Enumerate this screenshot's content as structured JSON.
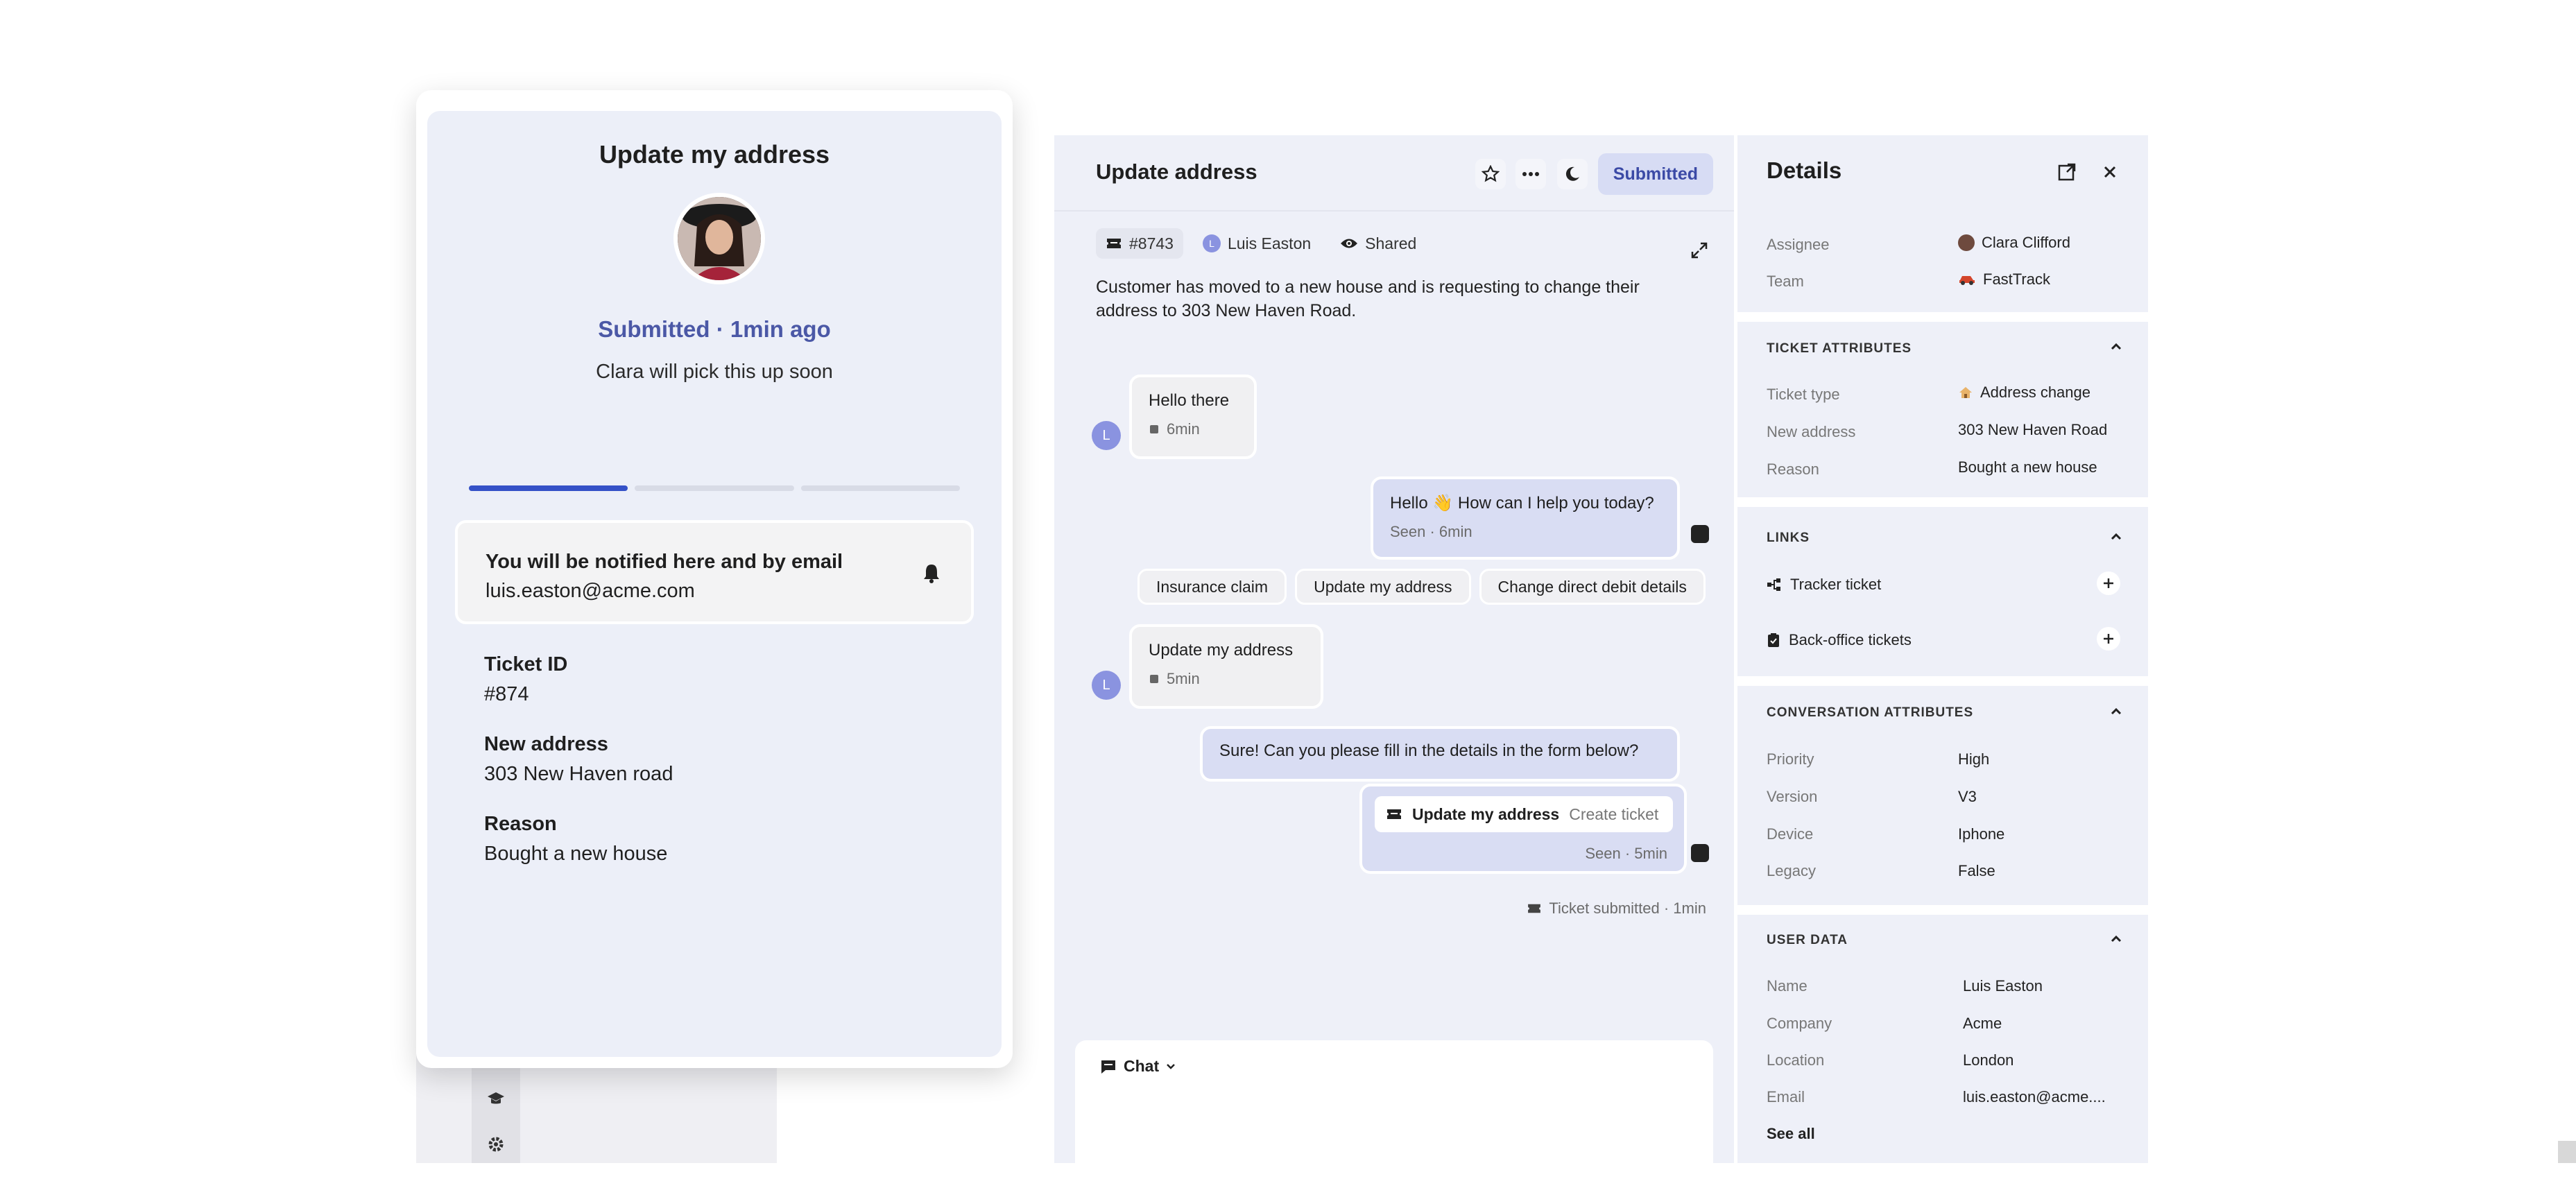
{
  "messenger": {
    "title": "Update my address",
    "status": "Submitted · 1min ago",
    "subtitle": "Clara will pick this up soon",
    "progress_steps_done": 1,
    "progress_steps_total": 3,
    "notify_title": "You will be notified here and by email",
    "notify_email": "luis.easton@acme.com",
    "fields": [
      {
        "label": "Ticket ID",
        "value": "#874"
      },
      {
        "label": "New address",
        "value": "303 New Haven road"
      },
      {
        "label": "Reason",
        "value": "Bought a new house"
      }
    ]
  },
  "conversation": {
    "title": "Update address",
    "status_pill": "Submitted",
    "ticket_number": "#8743",
    "customer_initial": "L",
    "customer_name": "Luis Easton",
    "visibility": "Shared",
    "description": "Customer has moved to a new house and is requesting to change their address to 303 New Haven Road.",
    "messages": [
      {
        "text": "Hello there",
        "meta": "6min"
      },
      {
        "text": "Hello 👋 How can I help you today?",
        "meta": "Seen · 6min"
      },
      {
        "text": "Update my address",
        "meta": "5min"
      },
      {
        "text": "Sure! Can you please fill in the details in the form below?",
        "meta": ""
      }
    ],
    "quick_replies": [
      "Insurance claim",
      "Update my address",
      "Change direct debit details"
    ],
    "ticket_card": {
      "title": "Update my address",
      "action": "Create ticket",
      "meta": "Seen · 5min"
    },
    "event": "Ticket submitted · 1min",
    "composer_mode": "Chat"
  },
  "details": {
    "title": "Details",
    "assignee_label": "Assignee",
    "assignee_value": "Clara Clifford",
    "team_label": "Team",
    "team_value": "FastTrack",
    "ticket_attributes": {
      "title": "TICKET ATTRIBUTES",
      "rows": [
        {
          "label": "Ticket type",
          "value": "Address change"
        },
        {
          "label": "New address",
          "value": "303 New Haven Road"
        },
        {
          "label": "Reason",
          "value": "Bought a new house"
        }
      ]
    },
    "links": {
      "title": "LINKS",
      "rows": [
        "Tracker ticket",
        "Back-office tickets"
      ]
    },
    "conversation_attributes": {
      "title": "CONVERSATION ATTRIBUTES",
      "rows": [
        {
          "label": "Priority",
          "value": "High"
        },
        {
          "label": "Version",
          "value": "V3"
        },
        {
          "label": "Device",
          "value": "Iphone"
        },
        {
          "label": "Legacy",
          "value": "False"
        }
      ]
    },
    "user_data": {
      "title": "USER DATA",
      "rows": [
        {
          "label": "Name",
          "value": "Luis Easton"
        },
        {
          "label": "Company",
          "value": "Acme"
        },
        {
          "label": "Location",
          "value": "London"
        },
        {
          "label": "Email",
          "value": "luis.easton@acme...."
        }
      ],
      "see_all": "See all"
    }
  },
  "colors": {
    "accent": "#3451c7",
    "status_text": "#4b58a6",
    "panel_bg": "#eef0f8",
    "bubble_out": "#d9ddf3"
  }
}
